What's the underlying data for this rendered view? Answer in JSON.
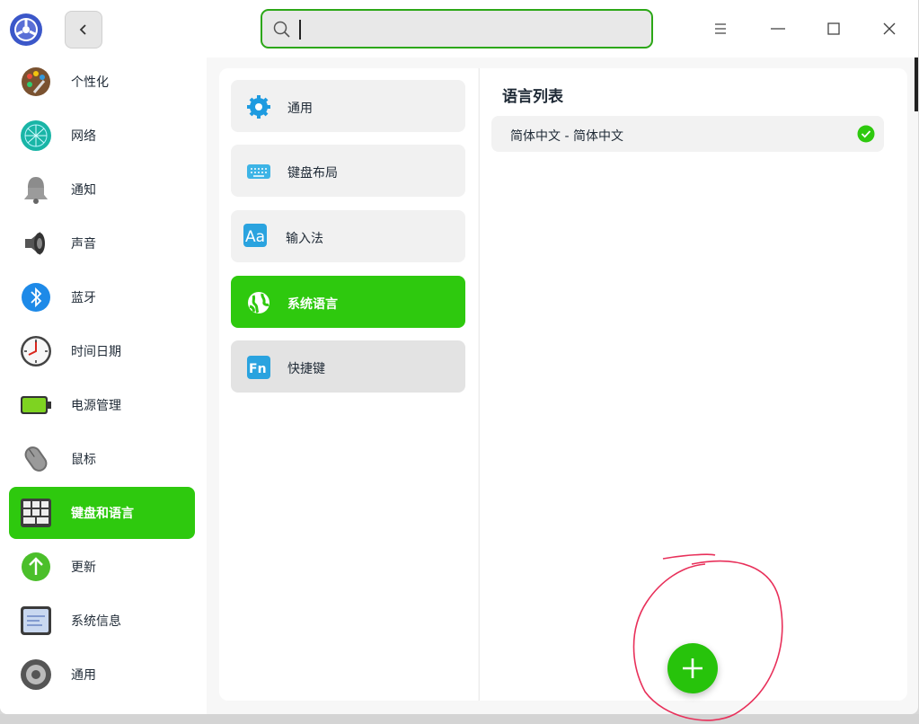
{
  "titlebar": {
    "app_icon": "control-center-icon",
    "back_icon": "chevron-left-icon",
    "search": {
      "value": "",
      "placeholder": ""
    },
    "menu_icon": "hamburger-icon",
    "minimize_icon": "minimize-icon",
    "maximize_icon": "maximize-icon",
    "close_icon": "close-icon"
  },
  "sidebar": {
    "items": [
      {
        "label": "个性化",
        "icon": "personalization-icon"
      },
      {
        "label": "网络",
        "icon": "network-icon"
      },
      {
        "label": "通知",
        "icon": "notification-bell-icon"
      },
      {
        "label": "声音",
        "icon": "speaker-icon"
      },
      {
        "label": "蓝牙",
        "icon": "bluetooth-icon"
      },
      {
        "label": "时间日期",
        "icon": "clock-icon"
      },
      {
        "label": "电源管理",
        "icon": "battery-icon"
      },
      {
        "label": "鼠标",
        "icon": "mouse-icon"
      },
      {
        "label": "键盘和语言",
        "icon": "keyboard-language-icon",
        "active": true
      },
      {
        "label": "更新",
        "icon": "update-arrow-icon"
      },
      {
        "label": "系统信息",
        "icon": "system-info-icon"
      },
      {
        "label": "通用",
        "icon": "general-gear-icon"
      }
    ]
  },
  "middle": {
    "items": [
      {
        "label": "通用",
        "icon": "gear-icon"
      },
      {
        "label": "键盘布局",
        "icon": "keyboard-icon"
      },
      {
        "label": "输入法",
        "icon": "input-method-icon"
      },
      {
        "label": "系统语言",
        "icon": "globe-language-icon",
        "active": true
      },
      {
        "label": "快捷键",
        "icon": "fn-key-icon"
      }
    ]
  },
  "right": {
    "title": "语言列表",
    "languages": [
      {
        "label": "简体中文 - 简体中文",
        "selected": true
      }
    ],
    "add_icon": "plus-icon"
  },
  "fn_label": "Fn",
  "input_method_label": "Aa",
  "colors": {
    "accent": "#2ec90e",
    "check": "#2ec90e",
    "annotation": "#e8305a"
  }
}
